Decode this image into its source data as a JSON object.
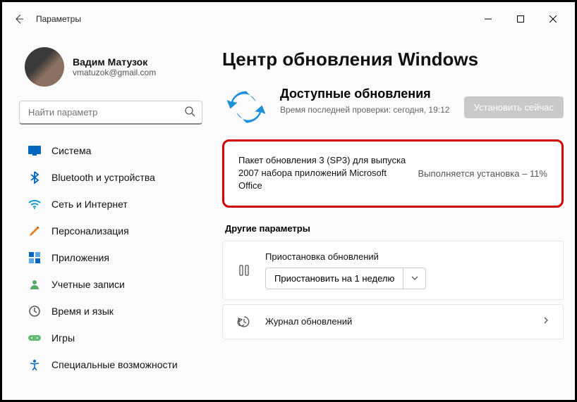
{
  "titlebar": {
    "title": "Параметры"
  },
  "profile": {
    "name": "Вадим Матузок",
    "email": "vmatuzok@gmail.com"
  },
  "search": {
    "placeholder": "Найти параметр"
  },
  "sidebar": {
    "items": [
      {
        "label": "Система"
      },
      {
        "label": "Bluetooth и устройства"
      },
      {
        "label": "Сеть и Интернет"
      },
      {
        "label": "Персонализация"
      },
      {
        "label": "Приложения"
      },
      {
        "label": "Учетные записи"
      },
      {
        "label": "Время и язык"
      },
      {
        "label": "Игры"
      },
      {
        "label": "Специальные возможности"
      }
    ]
  },
  "main": {
    "heading": "Центр обновления Windows",
    "available": {
      "title": "Доступные обновления",
      "subtitle": "Время последней проверки: сегодня, 19:12",
      "install_btn": "Установить сейчас"
    },
    "update": {
      "name": "Пакет обновления 3 (SP3) для выпуска 2007 набора приложений Microsoft Office",
      "status": "Выполняется установка – 11%"
    },
    "other_label": "Другие параметры",
    "pause": {
      "title": "Приостановка обновлений",
      "selected": "Приостановить на 1 неделю"
    },
    "history": {
      "title": "Журнал обновлений"
    }
  }
}
